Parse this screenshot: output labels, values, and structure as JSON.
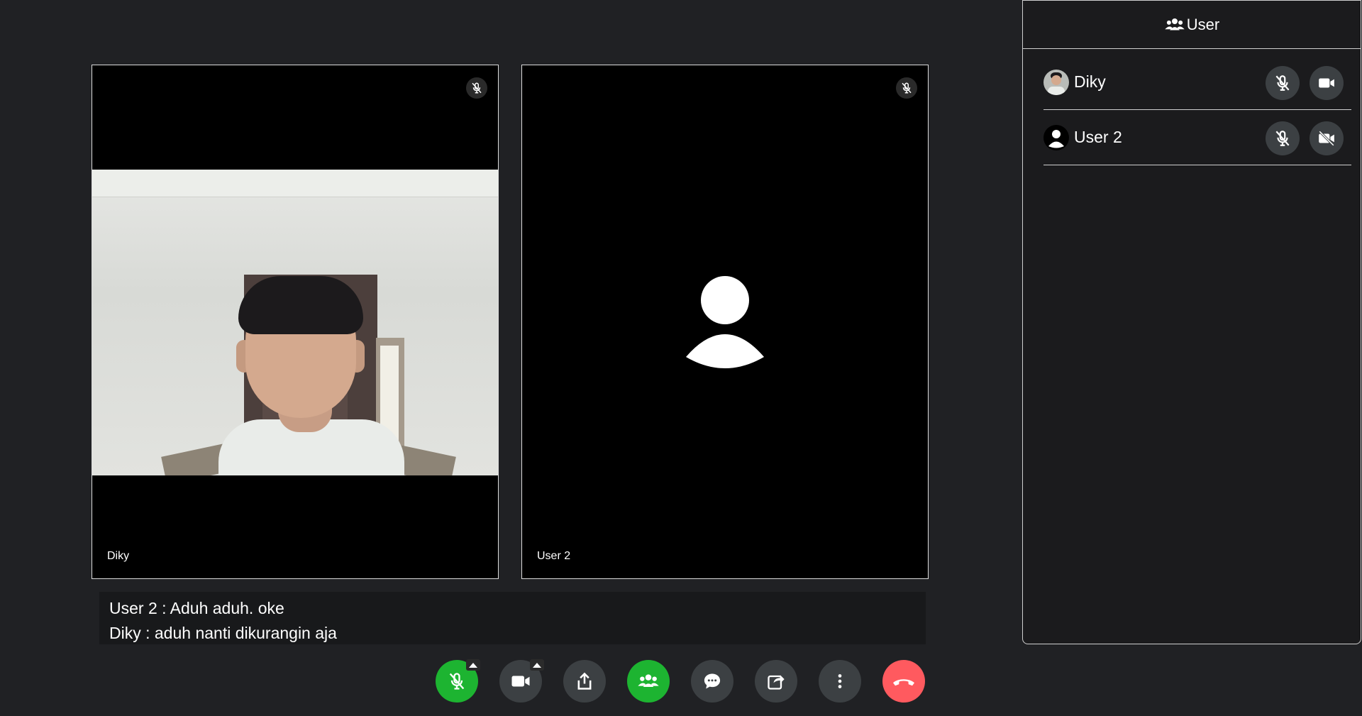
{
  "tiles": [
    {
      "name": "Diky",
      "mic_state": "muted",
      "video": "on"
    },
    {
      "name": "User 2",
      "mic_state": "muted",
      "video": "off"
    }
  ],
  "captions": [
    "User 2 : Aduh aduh. oke",
    "Diky : aduh nanti dikurangin aja"
  ],
  "toolbar": {
    "buttons": [
      {
        "icon": "mic-off-icon",
        "state": "muted",
        "color": "#1db431"
      },
      {
        "icon": "video-camera-icon",
        "color": "#3c4043"
      },
      {
        "icon": "share-screen-icon",
        "color": "#3c4043"
      },
      {
        "icon": "participants-icon",
        "state": "active",
        "color": "#1db431"
      },
      {
        "icon": "chat-icon",
        "color": "#3c4043"
      },
      {
        "icon": "share-link-icon",
        "color": "#3c4043"
      },
      {
        "icon": "more-vertical-icon",
        "color": "#3c4043"
      },
      {
        "icon": "hang-up-icon",
        "color": "#ff5a5f"
      }
    ]
  },
  "panel": {
    "title": "User",
    "participants": [
      {
        "name": "Diky",
        "mic": "muted",
        "camera": "on"
      },
      {
        "name": "User 2",
        "mic": "muted",
        "camera": "off"
      }
    ]
  },
  "colors": {
    "background": "#202124",
    "button": "#3c4043",
    "active": "#1db431",
    "end_call": "#ff5a5f"
  }
}
